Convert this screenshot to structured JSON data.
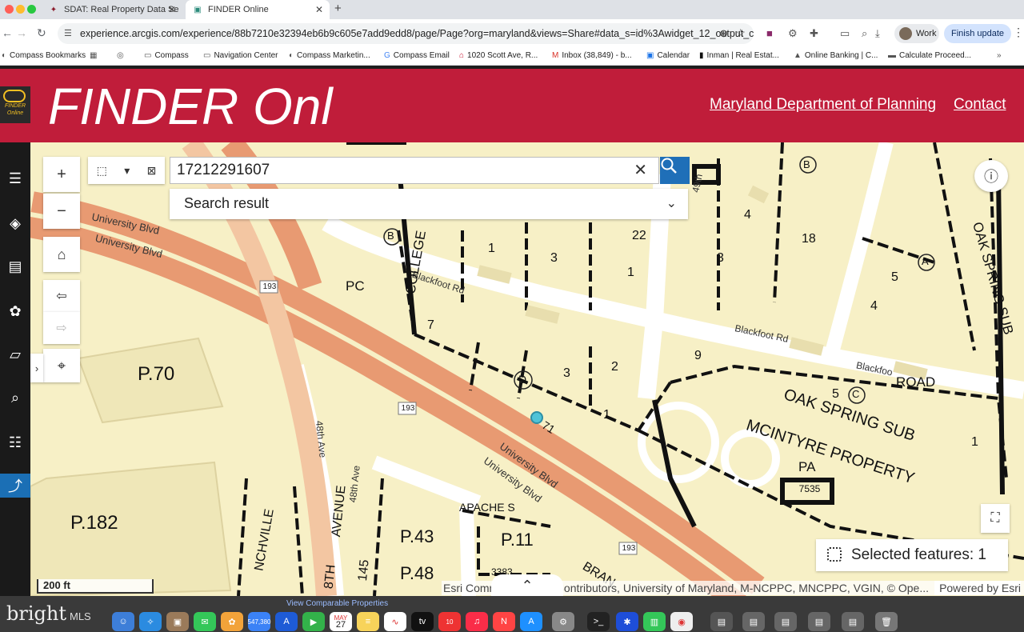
{
  "browser": {
    "tabs": [
      {
        "title": "SDAT: Real Property Data Se",
        "active": false
      },
      {
        "title": "FINDER Online",
        "active": true
      }
    ],
    "url": "experience.arcgis.com/experience/88b7210e32394eb6b9c605e7add9edd8/page/Page?org=maryland&views=Share#data_s=id%3Awidget_12_output_co...",
    "profile_label": "Work",
    "update_label": "Finish update"
  },
  "bookmarks": [
    "Compass Bookmarks",
    "Compass",
    "Navigation Center",
    "Compass Marketin...",
    "Compass Email",
    "1020 Scott Ave, R...",
    "Inbox (38,849) - b...",
    "Calendar",
    "Inman | Real Estat...",
    "Online Banking | C...",
    "Calculate Proceed..."
  ],
  "header": {
    "logo_text": "FINDER Online",
    "title": "FINDER Onl",
    "links": [
      "Maryland Department of Planning",
      "Contact"
    ]
  },
  "search": {
    "value": "17212291607",
    "result_label": "Search result"
  },
  "map": {
    "labels": {
      "road_university_1": "University Blvd",
      "road_university_2": "University Blvd",
      "road_university_3": "University Blvd",
      "road_university_4": "University Blvd",
      "road_blackfoot_1": "Blackfoot Rd",
      "road_blackfoot_2": "Blackfoot Rd",
      "road_blackfoot_3": "Blackfoo",
      "road_48th": "48th Ave",
      "road_48th_2": "48th Ave",
      "road_49th": "49th",
      "shield_193_a": "193",
      "shield_193_b": "193",
      "shield_193_c": "193",
      "p70": "P.70",
      "p182": "P.182",
      "p43": "P.43",
      "p48": "P.48",
      "p11": "P.11",
      "pc": "PC",
      "pa": "PA",
      "college": "COLLEGE",
      "road_word": "ROAD",
      "oak_spring_sub": "OAK SPRING SUB",
      "oak_spring_sub_v": "OAK SPRING SUB",
      "mcintyre": "MCINTYRE PROPERTY",
      "avenue": "AVENUE",
      "lot_7535": "7535",
      "apache": "APACHE S",
      "nchville": "NCHVILLE",
      "bran": "BRAN",
      "lot_145": "145",
      "lot_3383": "3383",
      "eighth": "8TH",
      "seven_one": "71"
    },
    "lot_numbers": [
      "1",
      "3",
      "1",
      "22",
      "7",
      "3",
      "2",
      "1",
      "9",
      "4",
      "18",
      "3",
      "5",
      "4",
      "5",
      "1"
    ],
    "lot_letters": [
      "B",
      "D",
      "B",
      "A",
      "C"
    ],
    "selected_features": "Selected features: 1",
    "scale_label": "200 ft",
    "attribution": "Esri Community Maps Contributors, University of Maryland, M-NCPPC, MNCPPC, VGIN, © Ope...",
    "powered_by": "Powered by Esri"
  },
  "dock": {
    "brand": "bright",
    "brand_suffix": "MLS",
    "view_comparable": "View Comparable Properties",
    "calendar_month": "MAY",
    "calendar_day": "27",
    "badge_mail": "547,380",
    "badge_news": "10"
  },
  "colors": {
    "header_red": "#c01d3a",
    "map_bg": "#f7f0c6",
    "road_orange": "#e89a72",
    "search_blue": "#1f6fb8",
    "selected_point": "#4fc3d8"
  }
}
